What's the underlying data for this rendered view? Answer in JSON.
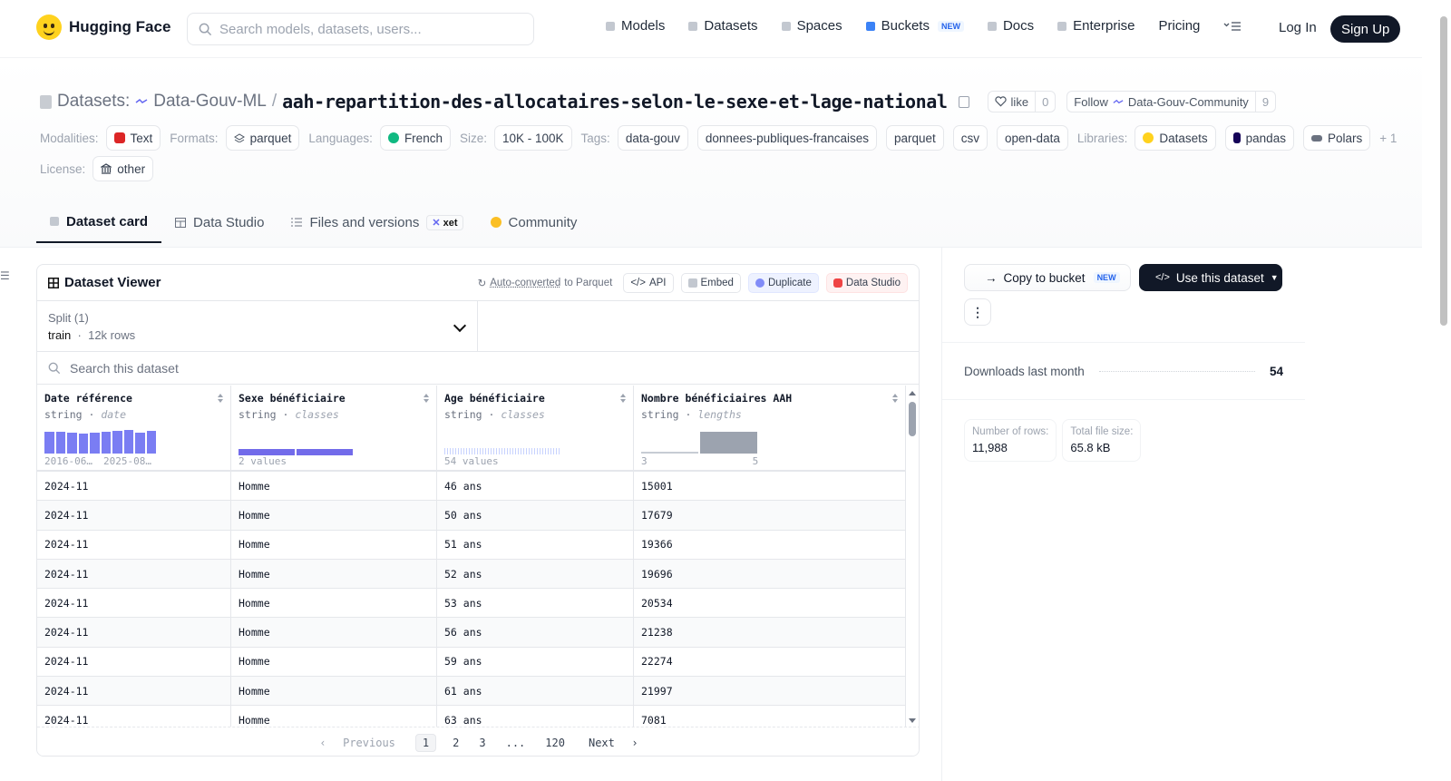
{
  "nav": {
    "brand": "Hugging Face",
    "search_placeholder": "Search models, datasets, users...",
    "links": {
      "models": "Models",
      "datasets": "Datasets",
      "spaces": "Spaces",
      "buckets": "Buckets",
      "buckets_badge": "NEW",
      "docs": "Docs",
      "enterprise": "Enterprise",
      "pricing": "Pricing"
    },
    "login": "Log In",
    "signup": "Sign Up"
  },
  "header": {
    "section_label": "Datasets:",
    "org": "Data-Gouv-ML",
    "repo": "aah-repartition-des-allocataires-selon-le-sexe-et-lage-national",
    "like_label": "like",
    "like_count": "0",
    "follow_label": "Follow",
    "follow_org": "Data-Gouv-Community",
    "follow_count": "9",
    "modalities_label": "Modalities:",
    "modality": "Text",
    "formats_label": "Formats:",
    "format": "parquet",
    "languages_label": "Languages:",
    "language": "French",
    "size_label": "Size:",
    "size": "10K - 100K",
    "tags_label": "Tags:",
    "tags": [
      "data-gouv",
      "donnees-publiques-francaises",
      "parquet",
      "csv",
      "open-data"
    ],
    "libraries_label": "Libraries:",
    "libraries": [
      "Datasets",
      "pandas",
      "Polars"
    ],
    "libraries_more": "+ 1",
    "license_label": "License:",
    "license": "other"
  },
  "tabs": {
    "card": "Dataset card",
    "studio": "Data Studio",
    "files": "Files and versions",
    "files_badge": "xet",
    "community": "Community"
  },
  "viewer": {
    "title": "Dataset Viewer",
    "auto_converted": "Auto-converted",
    "to_parquet": "to Parquet",
    "api": "API",
    "embed": "Embed",
    "duplicate": "Duplicate",
    "data_studio": "Data Studio",
    "split_label": "Split (1)",
    "split_name": "train",
    "split_rows": "12k rows",
    "search_placeholder": "Search this dataset",
    "columns": [
      {
        "name": "Date référence",
        "type": "string",
        "kind": "date",
        "foot_left": "2016-06…",
        "foot_right": "2025-08…"
      },
      {
        "name": "Sexe bénéficiaire",
        "type": "string",
        "kind": "classes",
        "foot_left": "2 values"
      },
      {
        "name": "Age bénéficiaire",
        "type": "string",
        "kind": "classes",
        "foot_left": "54 values"
      },
      {
        "name": "Nombre bénéficiaires AAH",
        "type": "string",
        "kind": "lengths",
        "foot_left": "3",
        "foot_right": "5"
      }
    ],
    "date_hist": [
      0.92,
      0.92,
      0.88,
      0.85,
      0.88,
      0.92,
      0.95,
      1.0,
      0.9,
      0.95
    ],
    "rows": [
      [
        "2024-11",
        "Homme",
        "46 ans",
        "15001"
      ],
      [
        "2024-11",
        "Homme",
        "50 ans",
        "17679"
      ],
      [
        "2024-11",
        "Homme",
        "51 ans",
        "19366"
      ],
      [
        "2024-11",
        "Homme",
        "52 ans",
        "19696"
      ],
      [
        "2024-11",
        "Homme",
        "53 ans",
        "20534"
      ],
      [
        "2024-11",
        "Homme",
        "56 ans",
        "21238"
      ],
      [
        "2024-11",
        "Homme",
        "59 ans",
        "22274"
      ],
      [
        "2024-11",
        "Homme",
        "61 ans",
        "21997"
      ],
      [
        "2024-11",
        "Homme",
        "63 ans",
        "7081"
      ]
    ],
    "pager": {
      "prev": "Previous",
      "pages": [
        "1",
        "2",
        "3",
        "...",
        "120"
      ],
      "next": "Next"
    }
  },
  "side": {
    "copy_bucket": "Copy to bucket",
    "copy_badge": "NEW",
    "use_dataset": "Use this dataset",
    "downloads_label": "Downloads last month",
    "downloads": "54",
    "rows_label": "Number of rows:",
    "rows_value": "11,988",
    "size_label": "Total file size:",
    "size_value": "65.8 kB"
  },
  "colors": {
    "accent": "#6366f1",
    "dark": "#111827",
    "brand": "#ffd21e"
  }
}
